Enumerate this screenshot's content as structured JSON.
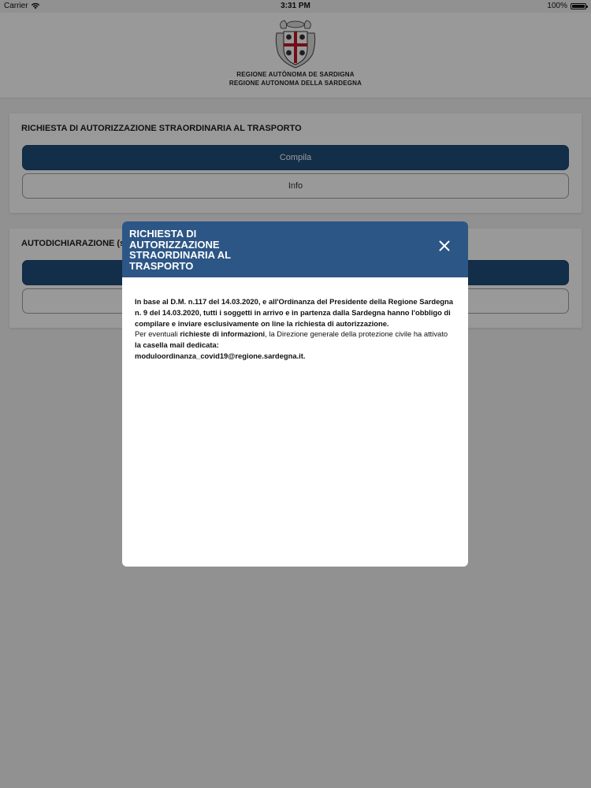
{
  "status_bar": {
    "carrier": "Carrier",
    "time": "3:31 PM",
    "battery": "100%",
    "wifi_icon": "wifi-icon",
    "battery_icon": "battery-icon"
  },
  "header": {
    "logo_icon": "coat-of-arms-icon",
    "line1": "REGIONE AUTÒNOMA DE SARDIGNA",
    "line2": "REGIONE AUTONOMA DELLA SARDEGNA"
  },
  "cards": [
    {
      "title": "RICHIESTA DI AUTORIZZAZIONE STRAORDINARIA AL TRASPORTO",
      "primary_label": "Compila",
      "secondary_label": "Info"
    },
    {
      "title": "AUTODICHIARAZIONE (so",
      "primary_label": "",
      "secondary_label": ""
    }
  ],
  "modal": {
    "title": "RICHIESTA DI AUTORIZZAZIONE STRAORDINARIA AL TRASPORTO",
    "close_icon": "close-icon",
    "paragraph1": "In base al D.M. n.117 del 14.03.2020, e all'Ordinanza del Presidente della Regione Sardegna n. 9 del 14.03.2020, tutti i soggetti in arrivo e in partenza dalla Sardegna hanno l'obbligo di compilare e inviare esclusivamente on line la richiesta di autorizzazione.",
    "paragraph2_prefix": "Per eventuali ",
    "paragraph2_bold": "richieste di informazioni",
    "paragraph2_suffix": ", la Direzione generale della protezione civile ha attivato",
    "paragraph2_line2": "la casella mail dedicata:",
    "email": "moduloordinanza_covid19@regione.sardegna.it."
  },
  "colors": {
    "primary": "#1f4e7a",
    "modal_header": "#2c5685",
    "background": "#f2f2f2"
  }
}
